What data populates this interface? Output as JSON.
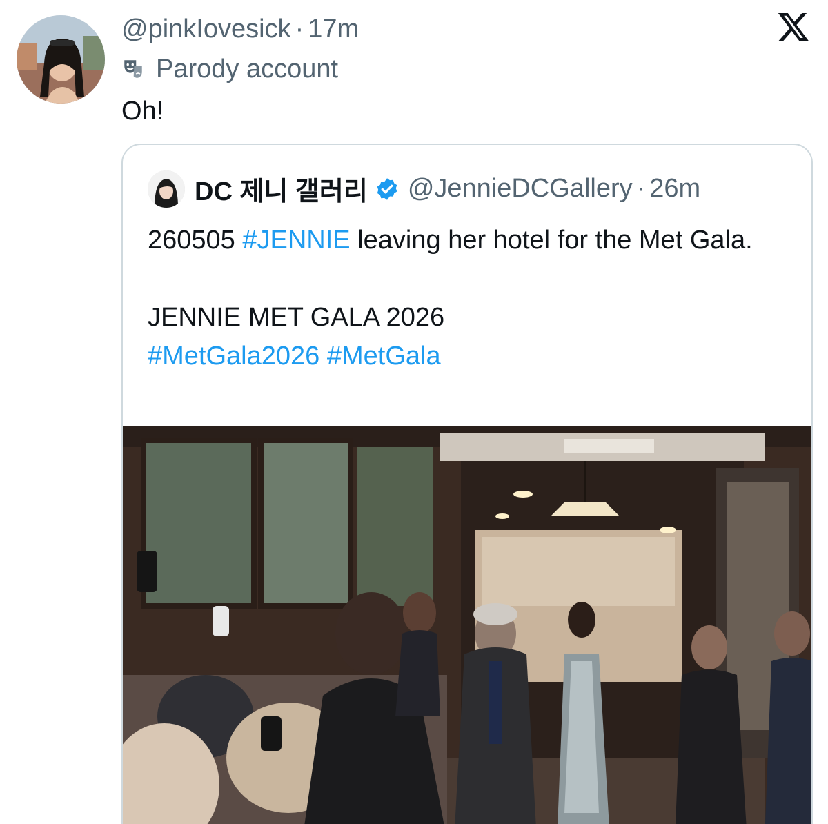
{
  "post": {
    "handle": "@pinkIovesick",
    "separator": "·",
    "time": "17m",
    "label": "Parody account",
    "text": "Oh!",
    "avatar_icon": "user-avatar-photo",
    "label_icon": "theater-masks-icon",
    "logo_icon": "x-logo-icon"
  },
  "quoted": {
    "display_name": "DC 제니 갤러리",
    "handle": "@JennieDCGallery",
    "separator": "·",
    "time": "26m",
    "verified_icon": "verified-badge-icon",
    "verified_color": "#1d9bf0",
    "text_parts": {
      "date": "260505 ",
      "hashtag_jennie": "#JENNIE",
      "rest": " leaving her hotel for the Met Gala.",
      "line2": "JENNIE MET GALA 2026",
      "hashtag_metgala2026": "#MetGala2026",
      "hashtag_space": " ",
      "hashtag_metgala": "#MetGala"
    },
    "link_color": "#1d9bf0",
    "media": "video-thumbnail-hotel-exit"
  }
}
